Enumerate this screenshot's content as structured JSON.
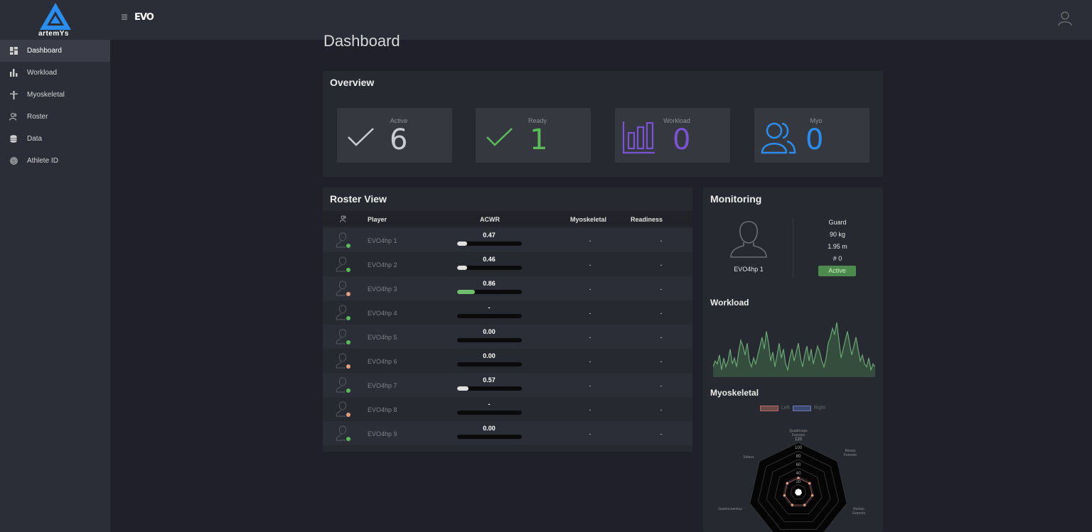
{
  "app": {
    "logo_text": "artemYs",
    "brand": "EVO"
  },
  "colors": {
    "accent_green": "#5bbb5b",
    "workload_purple": "#7b54d6",
    "myo_blue": "#2a8ef0",
    "bar_fill_white": "#e0e0e0",
    "bar_fill_green": "#6fbf6f"
  },
  "sidebar": {
    "items": [
      {
        "label": "Dashboard",
        "icon": "dashboard-icon",
        "active": true
      },
      {
        "label": "Workload",
        "icon": "bar-chart-icon",
        "active": false
      },
      {
        "label": "Myoskeletal",
        "icon": "body-icon",
        "active": false
      },
      {
        "label": "Roster",
        "icon": "users-icon",
        "active": false
      },
      {
        "label": "Data",
        "icon": "database-icon",
        "active": false
      },
      {
        "label": "Athlete ID",
        "icon": "fingerprint-icon",
        "active": false
      }
    ]
  },
  "page": {
    "title": "Dashboard"
  },
  "overview": {
    "title": "Overview",
    "stats": [
      {
        "label": "Active",
        "value": "6",
        "icon": "check-icon",
        "color": "#c9ccd2"
      },
      {
        "label": "Ready",
        "value": "1",
        "icon": "check-icon",
        "color": "#5bbb5b"
      },
      {
        "label": "Workload",
        "value": "0",
        "icon": "bar-chart-icon",
        "color": "#7b54d6"
      },
      {
        "label": "Myo",
        "value": "0",
        "icon": "users-icon",
        "color": "#2a8ef0"
      }
    ]
  },
  "roster": {
    "title": "Roster View",
    "headers": {
      "player": "Player",
      "acwr": "ACWR",
      "myoskeletal": "Myoskeletal",
      "readiness": "Readiness"
    },
    "rows": [
      {
        "name": "EVO4hp 1",
        "acwr": "0.47",
        "fill": 0.15,
        "fill_color": "#e0e0e0",
        "myo": "-",
        "ready": "-",
        "status": "#5bbb5b"
      },
      {
        "name": "EVO4hp 2",
        "acwr": "0.46",
        "fill": 0.15,
        "fill_color": "#e0e0e0",
        "myo": "-",
        "ready": "-",
        "status": "#5bbb5b"
      },
      {
        "name": "EVO4hp 3",
        "acwr": "0.86",
        "fill": 0.27,
        "fill_color": "#6fbf6f",
        "myo": "-",
        "ready": "-",
        "status": "#e0a080"
      },
      {
        "name": "EVO4hp 4",
        "acwr": "-",
        "fill": 0,
        "fill_color": "#e0e0e0",
        "myo": "-",
        "ready": "-",
        "status": "#5bbb5b"
      },
      {
        "name": "EVO4hp 5",
        "acwr": "0.00",
        "fill": 0,
        "fill_color": "#e0e0e0",
        "myo": "-",
        "ready": "-",
        "status": "#5bbb5b"
      },
      {
        "name": "EVO4hp 6",
        "acwr": "0.00",
        "fill": 0,
        "fill_color": "#e0e0e0",
        "myo": "-",
        "ready": "-",
        "status": "#e0a080"
      },
      {
        "name": "EVO4hp 7",
        "acwr": "0.57",
        "fill": 0.18,
        "fill_color": "#e0e0e0",
        "myo": "-",
        "ready": "-",
        "status": "#5bbb5b"
      },
      {
        "name": "EVO4hp 8",
        "acwr": "-",
        "fill": 0,
        "fill_color": "#e0e0e0",
        "myo": "-",
        "ready": "-",
        "status": "#e0a080"
      },
      {
        "name": "EVO4hp 9",
        "acwr": "0.00",
        "fill": 0,
        "fill_color": "#e0e0e0",
        "myo": "-",
        "ready": "-",
        "status": "#5bbb5b"
      }
    ]
  },
  "monitoring": {
    "title": "Monitoring",
    "player_name": "EVO4hp 1",
    "position": "Guard",
    "weight": "90 kg",
    "height": "1.95 m",
    "number": "# 0",
    "status": "Active",
    "workload_title": "Workload",
    "workload_series": [
      3,
      5,
      4,
      7,
      2,
      6,
      3,
      5,
      9,
      4,
      6,
      3,
      8,
      12,
      10,
      7,
      11,
      5,
      3,
      6,
      4,
      7,
      10,
      13,
      9,
      15,
      11,
      5,
      8,
      3,
      7,
      11,
      6,
      9,
      4,
      2,
      6,
      9,
      5,
      8,
      11,
      6,
      3,
      7,
      10,
      5,
      9,
      4,
      7,
      10,
      8,
      5,
      3,
      6,
      11,
      13,
      16,
      14,
      18,
      12,
      6,
      9,
      12,
      15,
      11,
      7,
      10,
      13,
      9,
      5,
      7,
      4,
      3,
      6,
      2,
      4,
      3
    ]
  },
  "myoskeletal": {
    "title": "Myoskeletal",
    "legend": [
      "Left",
      "Right"
    ],
    "axes": [
      "Quadriceps Femoris",
      "Biceps Femoris",
      "Rectus Femoris",
      "Gastrocnemius",
      "Soleus"
    ],
    "ticks": [
      "20",
      "40",
      "60",
      "80",
      "100",
      "120"
    ]
  }
}
